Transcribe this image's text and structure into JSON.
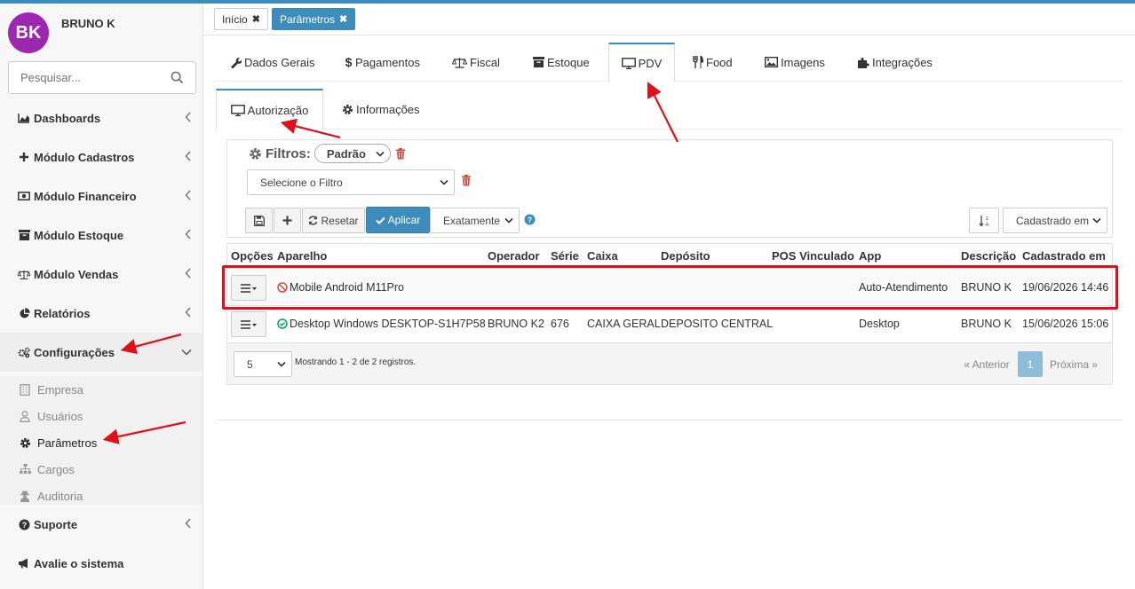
{
  "user": {
    "initials": "BK",
    "name": "BRUNO K"
  },
  "sidebar": {
    "search_placeholder": "Pesquisar...",
    "items": [
      {
        "label": "Dashboards",
        "icon": "area-chart-icon"
      },
      {
        "label": "Módulo Cadastros",
        "icon": "plus-icon"
      },
      {
        "label": "Módulo Financeiro",
        "icon": "money-icon"
      },
      {
        "label": "Módulo Estoque",
        "icon": "archive-icon"
      },
      {
        "label": "Módulo Vendas",
        "icon": "balance-scale-icon"
      },
      {
        "label": "Relatórios",
        "icon": "pie-chart-icon"
      },
      {
        "label": "Configurações",
        "icon": "cogs-icon"
      },
      {
        "label": "Suporte",
        "icon": "question-circle-icon"
      },
      {
        "label": "Avalie o sistema",
        "icon": "bullhorn-icon"
      }
    ],
    "submenu": [
      {
        "label": "Empresa",
        "icon": "building-icon"
      },
      {
        "label": "Usuários",
        "icon": "user-icon"
      },
      {
        "label": "Parâmetros",
        "icon": "gear-icon"
      },
      {
        "label": "Cargos",
        "icon": "sitemap-icon"
      },
      {
        "label": "Auditoria",
        "icon": "user-secret-icon"
      }
    ]
  },
  "open_tabs": [
    {
      "label": "Início",
      "close": "✖"
    },
    {
      "label": "Parâmetros",
      "close": "✖"
    }
  ],
  "main_tabs": [
    "Dados Gerais",
    "Pagamentos",
    "Fiscal",
    "Estoque",
    "PDV",
    "Food",
    "Imagens",
    "Integrações"
  ],
  "sub_tabs": [
    "Autorização",
    "Informações"
  ],
  "filters": {
    "title": "Filtros:",
    "preset": "Padrão",
    "select_placeholder": "Selecione o Filtro",
    "reset_label": "Resetar",
    "apply_label": "Aplicar",
    "match_mode": "Exatamente",
    "sort_field": "Cadastrado em"
  },
  "table": {
    "headers": [
      "Opções",
      "Aparelho",
      "Operador",
      "Série",
      "Caixa",
      "Depósito",
      "POS Vinculado",
      "App",
      "Descrição",
      "Cadastrado em"
    ],
    "rows": [
      {
        "status": "blocked",
        "aparelho": "Mobile Android M11Pro",
        "operador": "",
        "serie": "",
        "caixa": "",
        "deposito": "",
        "pos": "",
        "app": "Auto-Atendimento",
        "descricao": "BRUNO K",
        "cadastrado": "19/06/2026 14:46"
      },
      {
        "status": "ok",
        "aparelho": "Desktop Windows DESKTOP-S1H7P58",
        "operador": "BRUNO K2",
        "serie": "676",
        "caixa": "CAIXA GERAL",
        "deposito": "DEPOSITO CENTRAL",
        "pos": "",
        "app": "Desktop",
        "descricao": "BRUNO K",
        "cadastrado": "15/06/2026 15:06"
      }
    ],
    "page_size": "5",
    "summary": "Mostrando 1 - 2 de 2 registros.",
    "prev": "« Anterior",
    "page": "1",
    "next": "Próxima »"
  },
  "colors": {
    "accent": "#3c8dbc",
    "avatar": "#9c27b0",
    "annotation": "#e0101a",
    "danger": "#dd4b39",
    "success": "#00a65a"
  }
}
